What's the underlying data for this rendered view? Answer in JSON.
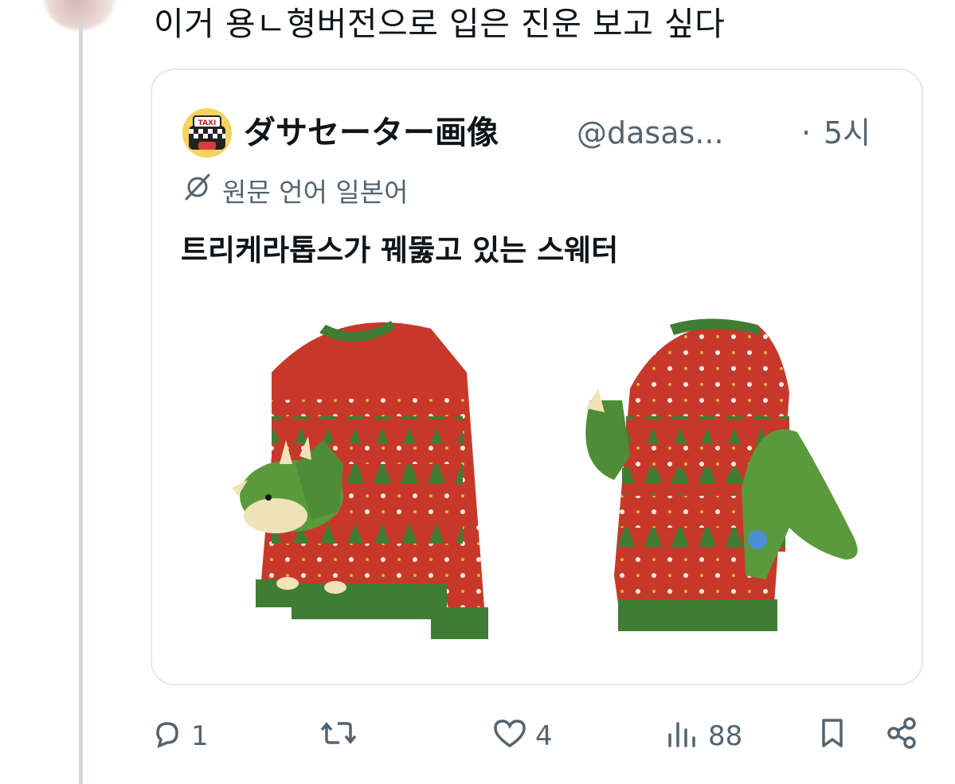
{
  "reply": {
    "text": "이거 용ㄴ형버전으로 입은 진운 보고 싶다"
  },
  "quote": {
    "author_name": "ダサセーター画像",
    "author_handle": "@dasas...",
    "separator": "·",
    "time": "5시",
    "translate_label": "원문 언어 일본어",
    "text": "트리케라톱스가 꿰뚫고 있는 스웨터",
    "media_icon": "christmas-sweater-dinosaur-photo"
  },
  "actions": {
    "reply_count": "1",
    "repost_count": "",
    "like_count": "4",
    "views_count": "88"
  },
  "colors": {
    "text": "#0f1419",
    "secondary": "#536471",
    "border": "#e3e8eb",
    "thread_line": "#cfd9de",
    "sweater_red": "#c8382a",
    "sweater_green": "#3f7d35"
  }
}
